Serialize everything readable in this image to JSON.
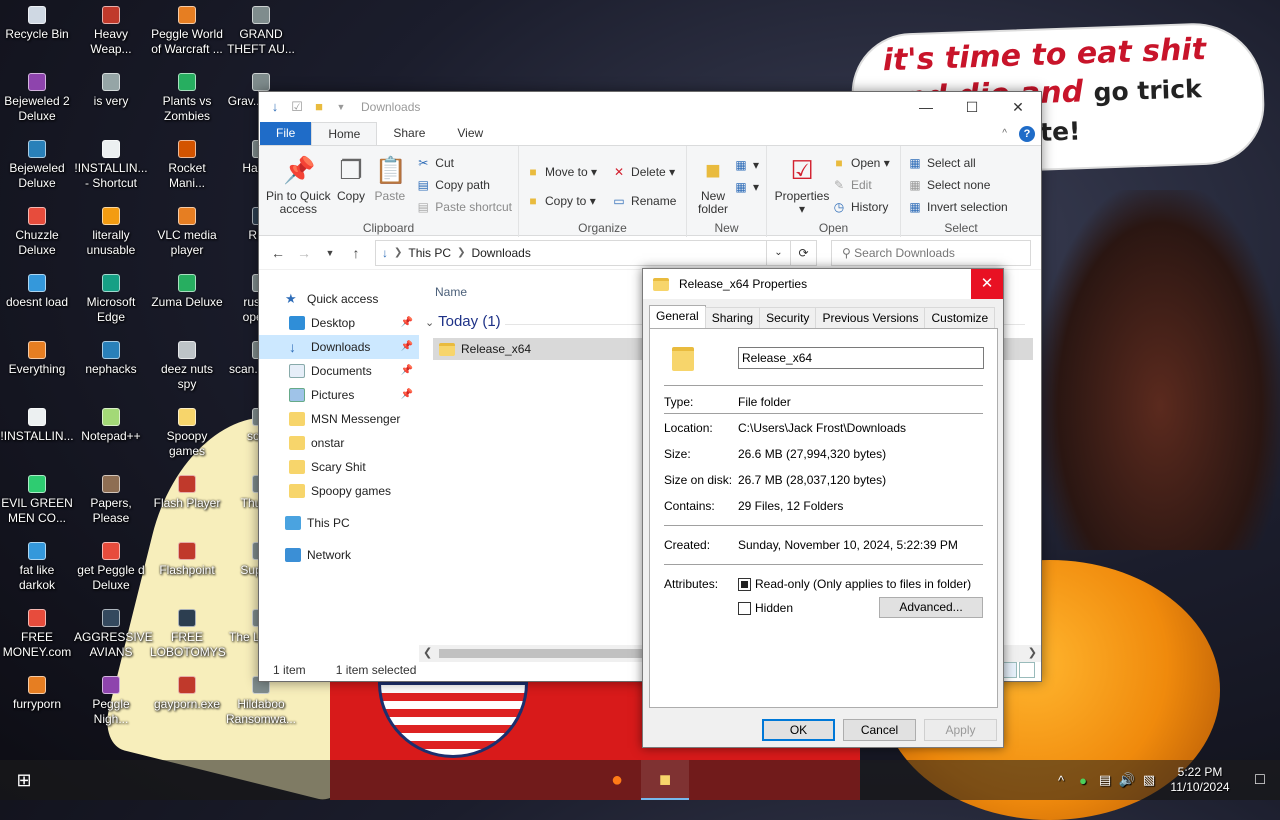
{
  "wallpaper": {
    "speech_line1": "it's time to eat shit",
    "speech_line2": "and die and",
    "speech_line3a": "go trick",
    "speech_line4": "and vote!"
  },
  "desktop_icons": [
    {
      "label": "Recycle Bin",
      "color": "#cfd8e3"
    },
    {
      "label": "Heavy Weap...",
      "color": "#c0392b"
    },
    {
      "label": "Peggle World of Warcraft ...",
      "color": "#e67e22"
    },
    {
      "label": "GRAND THEFT AU...",
      "color": "#7f8c8d"
    },
    {
      "label": "Bejeweled 2 Deluxe",
      "color": "#8e44ad"
    },
    {
      "label": "is very",
      "color": "#95a5a6"
    },
    {
      "label": "Plants vs Zombies",
      "color": "#27ae60"
    },
    {
      "label": "Grav... Party",
      "color": "#7f8c8d"
    },
    {
      "label": "Bejeweled Deluxe",
      "color": "#2980b9"
    },
    {
      "label": "!INSTALLIN... - Shortcut",
      "color": "#ecf0f1"
    },
    {
      "label": "Rocket Mani...",
      "color": "#d35400"
    },
    {
      "label": "Hallo...",
      "color": "#7f8c8d"
    },
    {
      "label": "Chuzzle Deluxe",
      "color": "#e74c3c"
    },
    {
      "label": "literally unusable",
      "color": "#f39c12"
    },
    {
      "label": "VLC media player",
      "color": "#e67e22"
    },
    {
      "label": "RDP",
      "color": "#2c3e50"
    },
    {
      "label": "doesnt load",
      "color": "#3498db"
    },
    {
      "label": "Microsoft Edge",
      "color": "#16a085"
    },
    {
      "label": "Zuma Deluxe",
      "color": "#27ae60"
    },
    {
      "label": "russi... open...",
      "color": "#7f8c8d"
    },
    {
      "label": "Everything",
      "color": "#e67e22"
    },
    {
      "label": "nephacks",
      "color": "#2980b9"
    },
    {
      "label": "deez nuts spy",
      "color": "#bdc3c7"
    },
    {
      "label": "scan... libr...",
      "color": "#7f8c8d"
    },
    {
      "label": "!INSTALLIN...",
      "color": "#ecf0f1"
    },
    {
      "label": "Notepad++",
      "color": "#a3d977"
    },
    {
      "label": "Spoopy games",
      "color": "#f7d56b"
    },
    {
      "label": "soli...",
      "color": "#7f8c8d"
    },
    {
      "label": "EVIL GREEN MEN CO...",
      "color": "#2ecc71"
    },
    {
      "label": "Papers, Please",
      "color": "#8e6e53"
    },
    {
      "label": "Flash Player",
      "color": "#c0392b"
    },
    {
      "label": "Thum...",
      "color": "#7f8c8d"
    },
    {
      "label": "fat like darkok",
      "color": "#3498db"
    },
    {
      "label": "get Peggle d Deluxe",
      "color": "#e74c3c"
    },
    {
      "label": "Flashpoint",
      "color": "#c0392b"
    },
    {
      "label": "Super...",
      "color": "#7f8c8d"
    },
    {
      "label": "FREE MONEY.com",
      "color": "#e74c3c"
    },
    {
      "label": "AGGRESSIVE AVIANS",
      "color": "#34495e"
    },
    {
      "label": "FREE LOBOTOMYS",
      "color": "#2c3e50"
    },
    {
      "label": "The L... of...",
      "color": "#7f8c8d"
    },
    {
      "label": "furryporn",
      "color": "#e67e22"
    },
    {
      "label": "Peggle Nigh...",
      "color": "#8e44ad"
    },
    {
      "label": "gayporn.exe",
      "color": "#c0392b"
    },
    {
      "label": "Hildaboo Ransomwa...",
      "color": "#7f8c8d"
    }
  ],
  "explorer": {
    "title": "Downloads",
    "tabs": {
      "file": "File",
      "home": "Home",
      "share": "Share",
      "view": "View"
    },
    "ribbon": {
      "pin_to_quick_access": "Pin to Quick access",
      "copy": "Copy",
      "paste": "Paste",
      "cut": "Cut",
      "copy_path": "Copy path",
      "paste_shortcut": "Paste shortcut",
      "clipboard_label": "Clipboard",
      "move_to": "Move to",
      "copy_to": "Copy to",
      "delete": "Delete",
      "rename": "Rename",
      "organize_label": "Organize",
      "new_folder": "New folder",
      "new_label": "New",
      "properties": "Properties",
      "open": "Open",
      "edit": "Edit",
      "history": "History",
      "open_label": "Open",
      "select_all": "Select all",
      "select_none": "Select none",
      "invert_selection": "Invert selection",
      "select_label": "Select"
    },
    "address": {
      "this_pc": "This PC",
      "downloads": "Downloads"
    },
    "search_placeholder": "Search Downloads",
    "nav": {
      "quick_access": "Quick access",
      "desktop": "Desktop",
      "downloads": "Downloads",
      "documents": "Documents",
      "pictures": "Pictures",
      "msn": "MSN Messenger",
      "onstar": "onstar",
      "scary": "Scary Shit",
      "spoopy": "Spoopy games",
      "this_pc": "This PC",
      "network": "Network"
    },
    "column_name": "Name",
    "group_today": "Today (1)",
    "file_name": "Release_x64",
    "status_items": "1 item",
    "status_selected": "1 item selected"
  },
  "properties": {
    "title": "Release_x64 Properties",
    "tabs": [
      "General",
      "Sharing",
      "Security",
      "Previous Versions",
      "Customize"
    ],
    "name_value": "Release_x64",
    "type_label": "Type:",
    "type_value": "File folder",
    "location_label": "Location:",
    "location_value": "C:\\Users\\Jack Frost\\Downloads",
    "size_label": "Size:",
    "size_value": "26.6 MB (27,994,320 bytes)",
    "size_on_disk_label": "Size on disk:",
    "size_on_disk_value": "26.7 MB (28,037,120 bytes)",
    "contains_label": "Contains:",
    "contains_value": "29 Files, 12 Folders",
    "created_label": "Created:",
    "created_value": "Sunday, November 10, 2024, 5:22:39 PM",
    "attributes_label": "Attributes:",
    "readonly_label": "Read-only (Only applies to files in folder)",
    "hidden_label": "Hidden",
    "advanced": "Advanced...",
    "ok": "OK",
    "cancel": "Cancel",
    "apply": "Apply"
  },
  "taskbar": {
    "time": "5:22 PM",
    "date": "11/10/2024"
  }
}
